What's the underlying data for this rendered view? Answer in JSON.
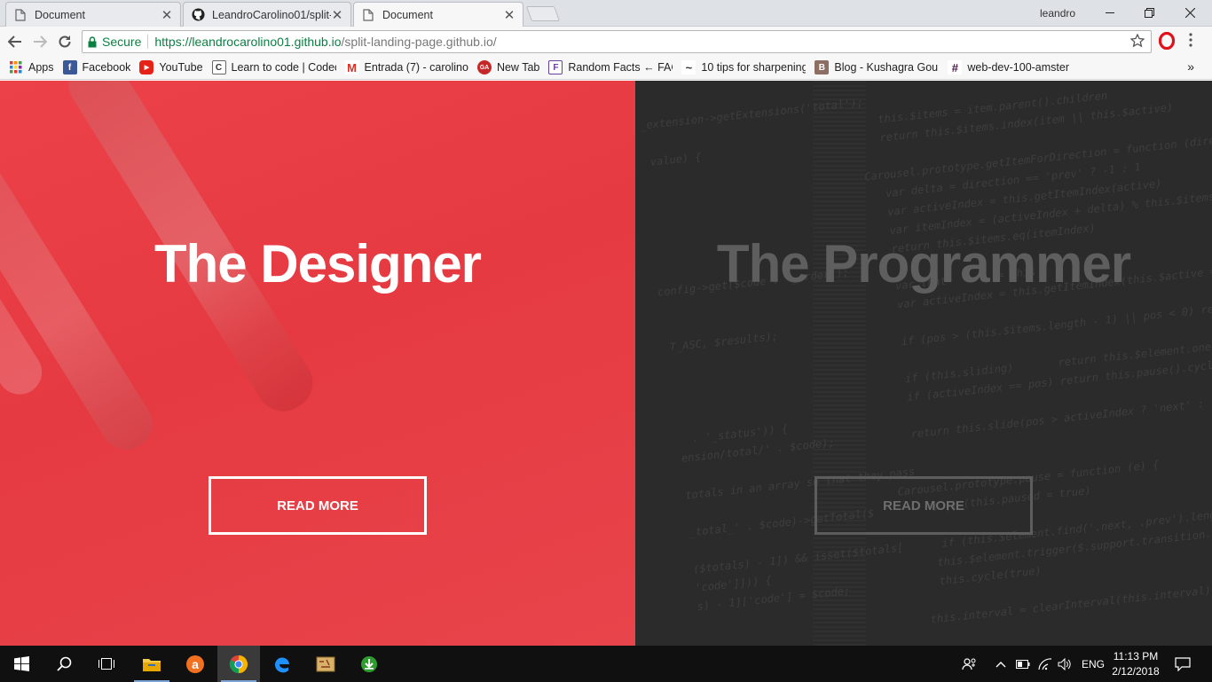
{
  "browser": {
    "tabs": [
      {
        "title": "Document",
        "active": false
      },
      {
        "title": "LeandroCarolino01/split-",
        "active": false
      },
      {
        "title": "Document",
        "active": true
      }
    ],
    "profile_name": "leandro",
    "omnibox": {
      "secure_label": "Secure",
      "url_host": "https://leandrocarolino01.github.io",
      "url_path": "/split-landing-page.github.io/"
    },
    "bookmarks": [
      {
        "label": "Apps",
        "icon": "apps-grid-icon"
      },
      {
        "label": "Facebook",
        "icon": "facebook-icon",
        "color": "#3b5998",
        "glyph": "f"
      },
      {
        "label": "YouTube",
        "icon": "youtube-icon",
        "color": "#e62117",
        "glyph": "▶"
      },
      {
        "label": "Learn to code | Codec",
        "icon": "codecademy-icon",
        "color": "#444",
        "glyph": "C"
      },
      {
        "label": "Entrada (7) - carolino",
        "icon": "gmail-icon",
        "color": "#d93025",
        "glyph": "M"
      },
      {
        "label": "New Tab",
        "icon": "newtab-icon",
        "color": "#c62828",
        "glyph": "GA"
      },
      {
        "label": "Random Facts ← FAC",
        "icon": "random-facts-icon",
        "color": "#6a3fa0",
        "glyph": "F"
      },
      {
        "label": "10 tips for sharpening",
        "icon": "tips-icon",
        "color": "#333",
        "glyph": "~"
      },
      {
        "label": "Blog - Kushagra Gour",
        "icon": "blog-icon",
        "color": "#8d6e63",
        "glyph": "B"
      },
      {
        "label": "web-dev-100-amster",
        "icon": "slack-icon",
        "color": "#4a154b",
        "glyph": "#"
      }
    ],
    "bookmarks_more": "»"
  },
  "page": {
    "left": {
      "title": "The Designer",
      "button": "READ MORE",
      "color": "#e8434a"
    },
    "right": {
      "title": "The Programmer",
      "button": "READ MORE",
      "color": "#2b2b2b"
    }
  },
  "taskbar": {
    "language": "ENG",
    "time": "11:13 PM",
    "date": "2/12/2018"
  }
}
